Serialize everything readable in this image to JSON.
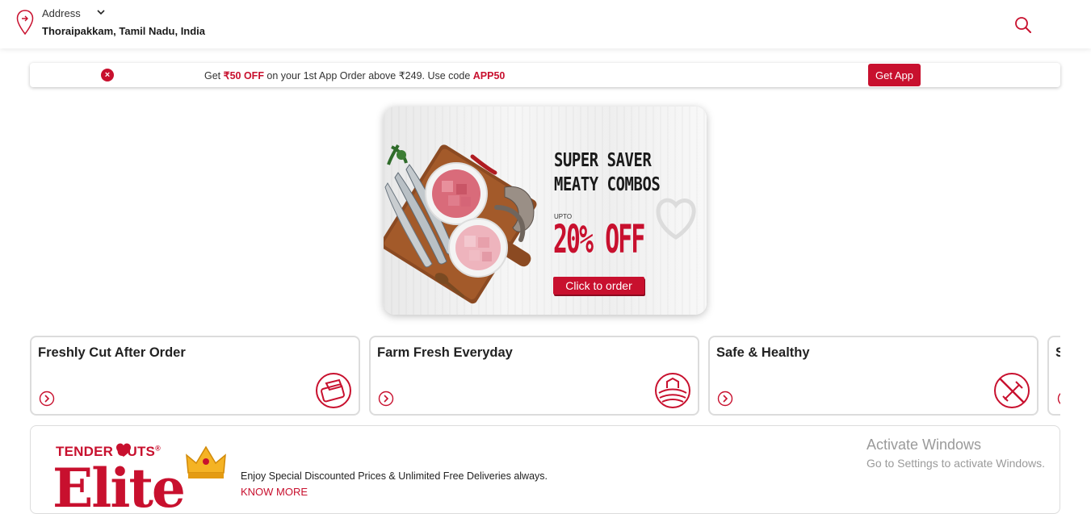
{
  "header": {
    "address_label": "Address",
    "address_value": "Thoraipakkam, Tamil Nadu, India"
  },
  "promo": {
    "text_prefix": "Get ",
    "discount": "₹50 OFF",
    "text_middle": " on your 1st App Order above ₹249. Use code ",
    "code": "APP50",
    "button_label": "Get App",
    "close_symbol": "×"
  },
  "banner": {
    "headline_line1": "SUPER SAVER",
    "headline_line2": "MEATY COMBOS",
    "upto": "UPTO",
    "discount": "20% OFF",
    "cta": "Click to order"
  },
  "features": [
    {
      "title": "Freshly Cut After Order",
      "icon": "cleaver-board-icon"
    },
    {
      "title": "Farm Fresh Everyday",
      "icon": "farm-icon"
    },
    {
      "title": "Safe & Healthy",
      "icon": "no-injection-icon"
    },
    {
      "title": "S",
      "icon": "arrow-right-circle-icon"
    }
  ],
  "elite": {
    "brand": "TENDER  CUTS",
    "registered": "®",
    "word": "Elite",
    "description": "Enjoy Special Discounted Prices & Unlimited Free Deliveries always.",
    "link": "KNOW MORE"
  },
  "watermark": {
    "line1": "Activate Windows",
    "line2": "Go to Settings to activate Windows."
  },
  "colors": {
    "brand": "#c8102e",
    "border": "#dcdcdc"
  }
}
